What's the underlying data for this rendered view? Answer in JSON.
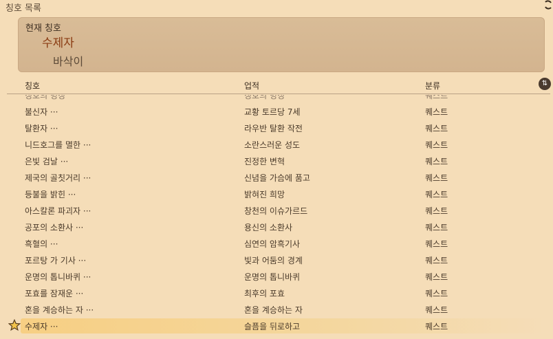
{
  "window": {
    "title": "칭호 목록"
  },
  "current": {
    "label": "현재 칭호",
    "title": "수제자",
    "subtitle": "바삭이"
  },
  "columns": {
    "title": "칭호",
    "achievement": "업적",
    "category": "분류"
  },
  "rows": [
    {
      "title": "칭호의 명칭",
      "achievement": "칭호의 명칭",
      "category": "퀘스트"
    },
    {
      "title": "불신자 ···",
      "achievement": "교황 토르당 7세",
      "category": "퀘스트"
    },
    {
      "title": "탈환자 ···",
      "achievement": "라우반 탈환 작전",
      "category": "퀘스트"
    },
    {
      "title": "니드호그를 멸한 ···",
      "achievement": "소란스러운 성도",
      "category": "퀘스트"
    },
    {
      "title": "은빛 검날 ···",
      "achievement": "진정한 변혁",
      "category": "퀘스트"
    },
    {
      "title": "제국의 골칫거리 ···",
      "achievement": "신념을 가슴에 품고",
      "category": "퀘스트"
    },
    {
      "title": "등불을 밝힌 ···",
      "achievement": "밝혀진 희망",
      "category": "퀘스트"
    },
    {
      "title": "아스칼론 파괴자 ···",
      "achievement": "창천의 이슈가르드",
      "category": "퀘스트"
    },
    {
      "title": "공포의 소환사 ···",
      "achievement": "용신의 소환사",
      "category": "퀘스트"
    },
    {
      "title": "흑혈의 ···",
      "achievement": "심연의 암흑기사",
      "category": "퀘스트"
    },
    {
      "title": "포르탕 가 기사 ···",
      "achievement": "빛과 어둠의 경계",
      "category": "퀘스트"
    },
    {
      "title": "운명의 톱니바퀴 ···",
      "achievement": "운명의 톱니바퀴",
      "category": "퀘스트"
    },
    {
      "title": "포효를 잠재운 ···",
      "achievement": "최후의 포효",
      "category": "퀘스트"
    },
    {
      "title": "혼을 계승하는 자 ···",
      "achievement": "혼을 계승하는 자",
      "category": "퀘스트"
    },
    {
      "title": "수제자 ···",
      "achievement": "슬픔을 뒤로하고",
      "category": "퀘스트"
    }
  ],
  "selected_index": 14,
  "colors": {
    "accent": "#8a3b12",
    "selected": "#f7cf83",
    "background": "#f5ddb8"
  }
}
